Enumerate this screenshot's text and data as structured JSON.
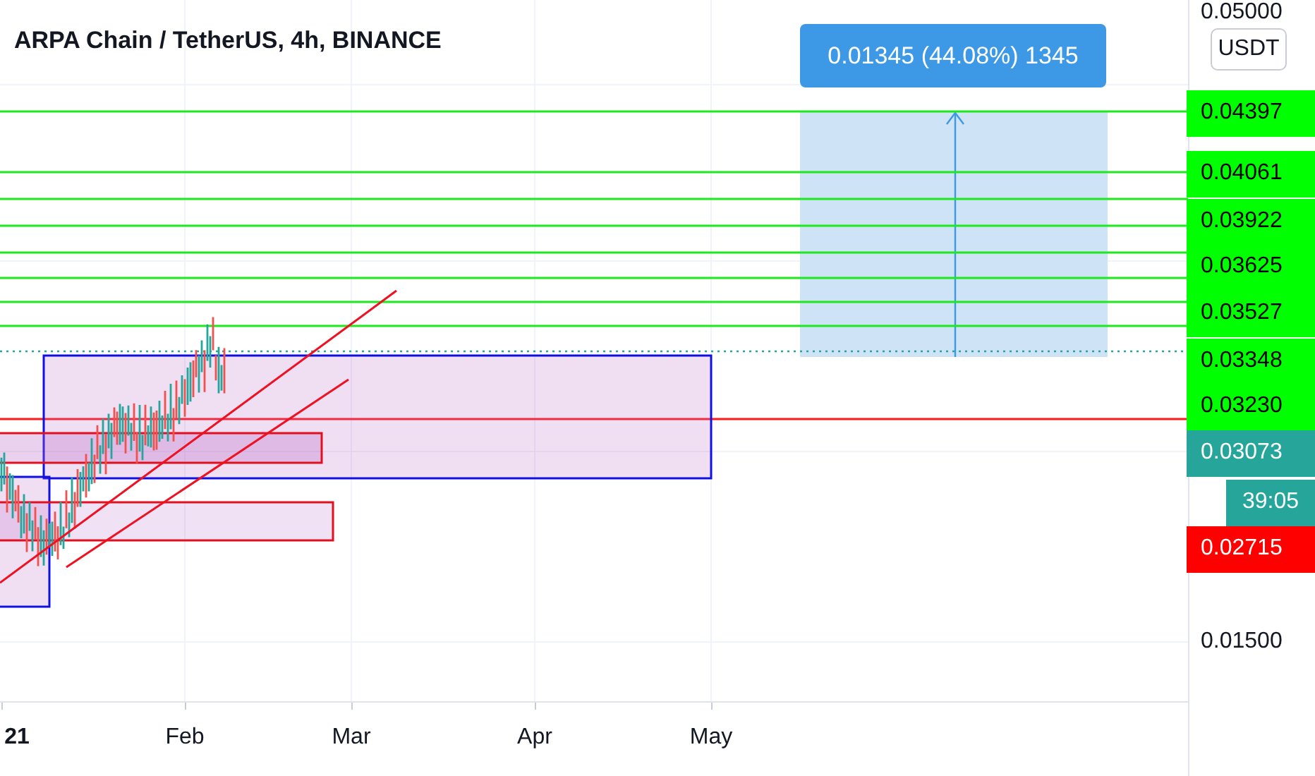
{
  "header": {
    "title": "ARPA Chain / TetherUS, 4h, BINANCE"
  },
  "measure": {
    "label": "0.01345 (44.08%) 1345"
  },
  "price_axis": {
    "currency_button": "USDT",
    "labels": [
      {
        "text": "0.05000",
        "kind": "plain"
      },
      {
        "text": "0.04397",
        "kind": "badge",
        "color": "#00ff00"
      },
      {
        "text": "0.04061",
        "kind": "badge",
        "color": "#00ff00"
      },
      {
        "text": "0.03922",
        "kind": "badge",
        "color": "#00ff00"
      },
      {
        "text": "0.03625",
        "kind": "badge",
        "color": "#00ff00"
      },
      {
        "text": "0.03527",
        "kind": "badge",
        "color": "#00ff00"
      },
      {
        "text": "0.03348",
        "kind": "badge",
        "color": "#00ff00"
      },
      {
        "text": "0.03230",
        "kind": "badge",
        "color": "#00ff00"
      },
      {
        "text": "0.03073",
        "kind": "badge",
        "color": "#26a69a"
      },
      {
        "text": "39:05",
        "kind": "countdown",
        "color": "#26a69a"
      },
      {
        "text": "0.02715",
        "kind": "badge",
        "color": "#ff0000"
      },
      {
        "text": "0.01500",
        "kind": "plain"
      }
    ]
  },
  "time_axis": {
    "labels": [
      {
        "text": "21",
        "kind": "year"
      },
      {
        "text": "Feb",
        "kind": "month"
      },
      {
        "text": "Mar",
        "kind": "month"
      },
      {
        "text": "Apr",
        "kind": "month"
      },
      {
        "text": "May",
        "kind": "month"
      }
    ]
  }
}
